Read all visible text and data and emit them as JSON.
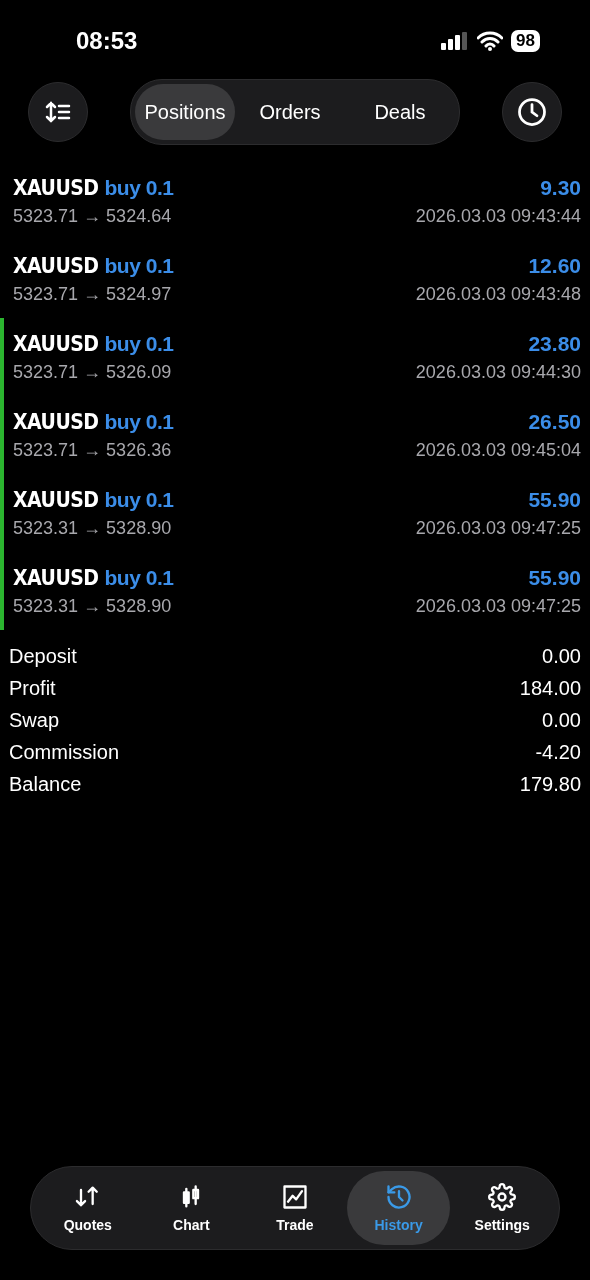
{
  "status_bar": {
    "time": "08:53",
    "battery": "98"
  },
  "tabs": [
    {
      "label": "Positions",
      "selected": true
    },
    {
      "label": "Orders",
      "selected": false
    },
    {
      "label": "Deals",
      "selected": false
    }
  ],
  "deals": [
    {
      "symbol": "XAUUSD",
      "side": "buy 0.1",
      "profit": "9.30",
      "open": "5323.71",
      "arrow": "→",
      "close": "5324.64",
      "time": "2026.03.03 09:43:44",
      "marked": false
    },
    {
      "symbol": "XAUUSD",
      "side": "buy 0.1",
      "profit": "12.60",
      "open": "5323.71",
      "arrow": "→",
      "close": "5324.97",
      "time": "2026.03.03 09:43:48",
      "marked": false
    },
    {
      "symbol": "XAUUSD",
      "side": "buy 0.1",
      "profit": "23.80",
      "open": "5323.71",
      "arrow": "→",
      "close": "5326.09",
      "time": "2026.03.03 09:44:30",
      "marked": true
    },
    {
      "symbol": "XAUUSD",
      "side": "buy 0.1",
      "profit": "26.50",
      "open": "5323.71",
      "arrow": "→",
      "close": "5326.36",
      "time": "2026.03.03 09:45:04",
      "marked": true
    },
    {
      "symbol": "XAUUSD",
      "side": "buy 0.1",
      "profit": "55.90",
      "open": "5323.31",
      "arrow": "→",
      "close": "5328.90",
      "time": "2026.03.03 09:47:25",
      "marked": true
    },
    {
      "symbol": "XAUUSD",
      "side": "buy 0.1",
      "profit": "55.90",
      "open": "5323.31",
      "arrow": "→",
      "close": "5328.90",
      "time": "2026.03.03 09:47:25",
      "marked": true
    }
  ],
  "summary": [
    {
      "label": "Deposit",
      "value": "0.00"
    },
    {
      "label": "Profit",
      "value": "184.00"
    },
    {
      "label": "Swap",
      "value": "0.00"
    },
    {
      "label": "Commission",
      "value": "-4.20"
    },
    {
      "label": "Balance",
      "value": "179.80"
    }
  ],
  "nav": [
    {
      "label": "Quotes",
      "selected": false
    },
    {
      "label": "Chart",
      "selected": false
    },
    {
      "label": "Trade",
      "selected": false
    },
    {
      "label": "History",
      "selected": true
    },
    {
      "label": "Settings",
      "selected": false
    }
  ]
}
